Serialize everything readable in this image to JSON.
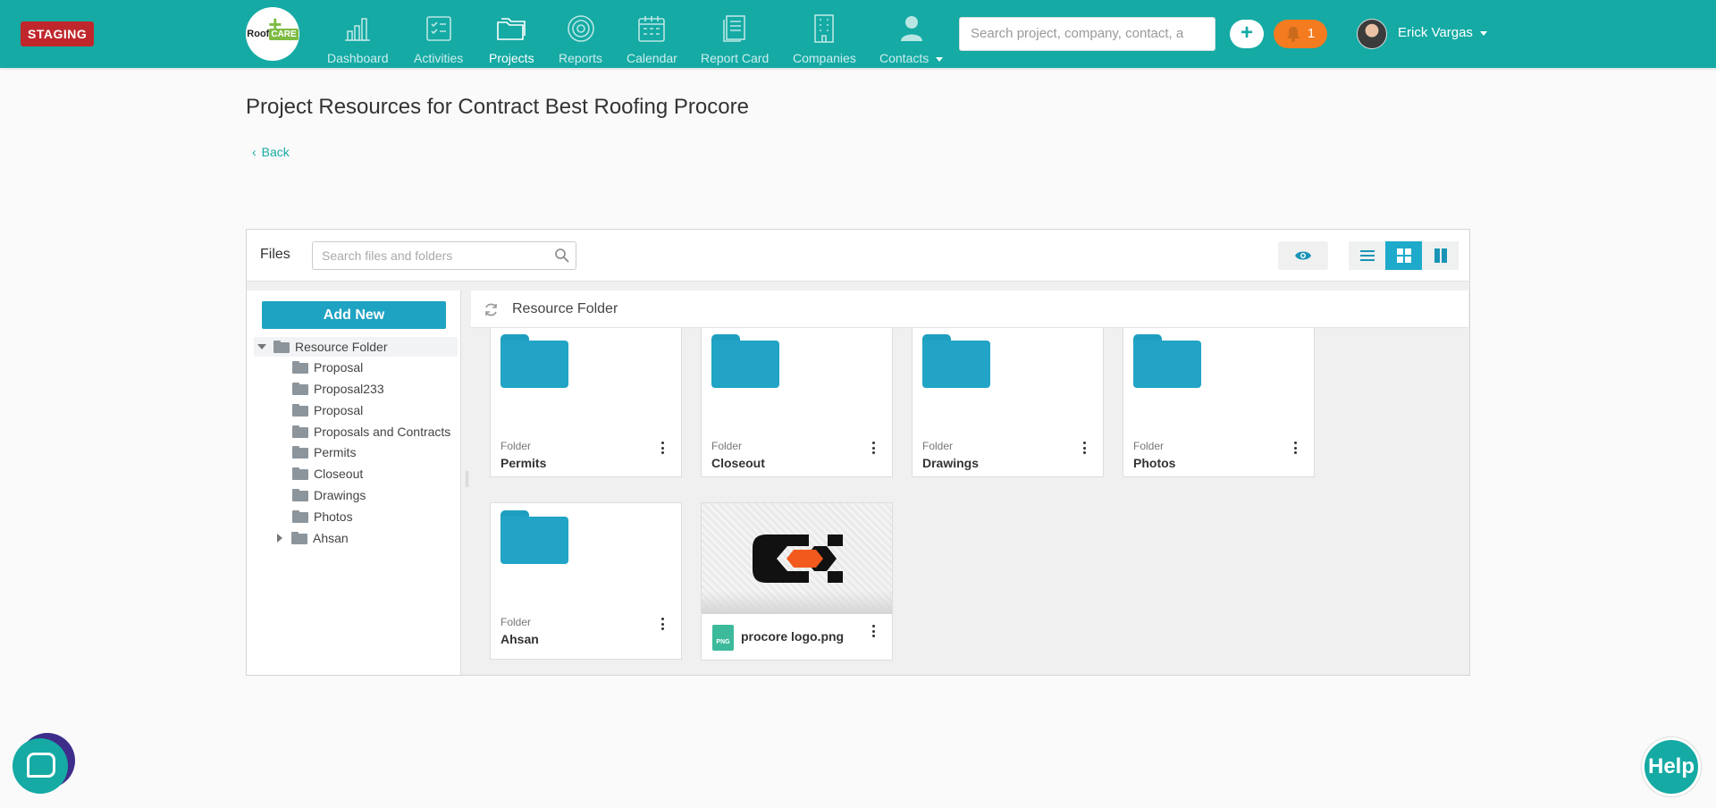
{
  "env_badge": "STAGING",
  "logo": {
    "text_a": "Roof",
    "text_b": "CARE"
  },
  "nav": [
    {
      "label": "Dashboard",
      "icon": "bar-chart-icon"
    },
    {
      "label": "Activities",
      "icon": "checklist-icon"
    },
    {
      "label": "Projects",
      "icon": "folders-icon",
      "active": true
    },
    {
      "label": "Reports",
      "icon": "target-icon"
    },
    {
      "label": "Calendar",
      "icon": "calendar-icon"
    },
    {
      "label": "Report Card",
      "icon": "document-icon"
    },
    {
      "label": "Companies",
      "icon": "building-icon"
    },
    {
      "label": "Contacts",
      "icon": "person-icon"
    }
  ],
  "top_search": {
    "placeholder": "Search project, company, contact, a"
  },
  "plus_label": "+",
  "notifications": {
    "count": "1"
  },
  "user": {
    "name": "Erick Vargas"
  },
  "page": {
    "title": "Project Resources for Contract Best Roofing Procore",
    "back_label": "Back"
  },
  "files": {
    "label": "Files",
    "search_placeholder": "Search files and folders",
    "add_new_label": "Add New",
    "breadcrumb": "Resource Folder",
    "tree": {
      "root": "Resource Folder",
      "children": [
        "Proposal",
        "Proposal233",
        "Proposal",
        "Proposals and Contracts",
        "Permits",
        "Closeout",
        "Drawings",
        "Photos",
        "Ahsan"
      ]
    },
    "items": [
      {
        "type": "Folder",
        "name": "Permits"
      },
      {
        "type": "Folder",
        "name": "Closeout"
      },
      {
        "type": "Folder",
        "name": "Drawings"
      },
      {
        "type": "Folder",
        "name": "Photos"
      },
      {
        "type": "Folder",
        "name": "Ahsan"
      },
      {
        "type": "PNG",
        "name": "procore logo.png"
      }
    ]
  },
  "help_label": "Help",
  "colors": {
    "brand": "#15aaa4",
    "accent": "#1fa3c2",
    "staging": "#c0272d",
    "notification": "#f47b20"
  }
}
